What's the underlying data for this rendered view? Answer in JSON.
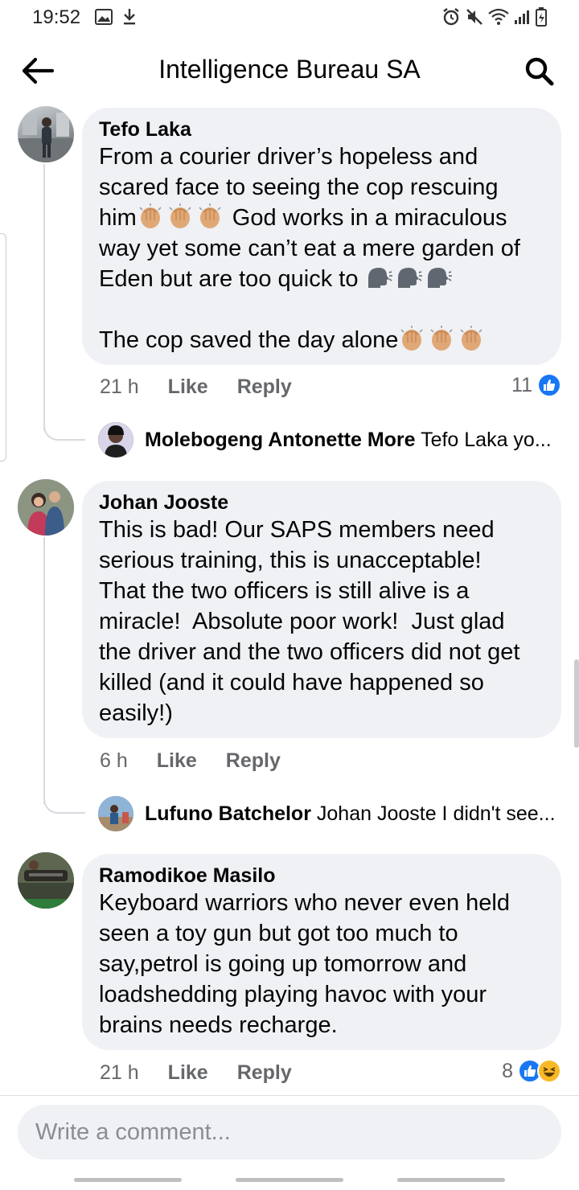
{
  "status_bar": {
    "time": "19:52"
  },
  "header": {
    "title": "Intelligence Bureau SA"
  },
  "comments": [
    {
      "author": "Tefo Laka",
      "lines": [
        "From a courier driver’s hopeless and",
        "scared face to seeing the cop rescuing",
        "him",
        "God works in a miraculous",
        "way yet some can’t eat a mere garden of",
        "Eden but are too quick to",
        "The cop saved the day alone"
      ],
      "time": "21 h",
      "like_label": "Like",
      "reply_label": "Reply",
      "reaction_count": "11",
      "reply_preview": {
        "name": "Molebogeng Antonette More",
        "snippet": "Tefo Laka yo..."
      }
    },
    {
      "author": "Johan Jooste",
      "text": "This is bad! Our SAPS members need\nserious training, this is unacceptable!\nThat the two officers is still alive is a\nmiracle!  Absolute poor work!  Just glad\nthe driver and the two officers did not get\nkilled (and it could have happened so\neasily!)",
      "time": "6 h",
      "like_label": "Like",
      "reply_label": "Reply",
      "reply_preview": {
        "name": "Lufuno Batchelor",
        "snippet": "Johan Jooste I didn't see..."
      }
    },
    {
      "author": "Ramodikoe Masilo",
      "text": "Keyboard warriors who never even held\nseen a toy gun but got too much to\nsay,petrol is going up tomorrow and\nloadshedding playing havoc with your\nbrains needs recharge.",
      "time": "21 h",
      "like_label": "Like",
      "reply_label": "Reply",
      "reaction_count": "8"
    }
  ],
  "composer": {
    "placeholder": "Write a comment..."
  },
  "colors": {
    "accent": "#1877f2",
    "bubble": "#eff1f4",
    "meta": "#65676b"
  },
  "icons": [
    "back-arrow-icon",
    "search-icon",
    "clap-emoji",
    "speaking-head-emoji",
    "like-reaction-icon",
    "haha-reaction-icon"
  ]
}
